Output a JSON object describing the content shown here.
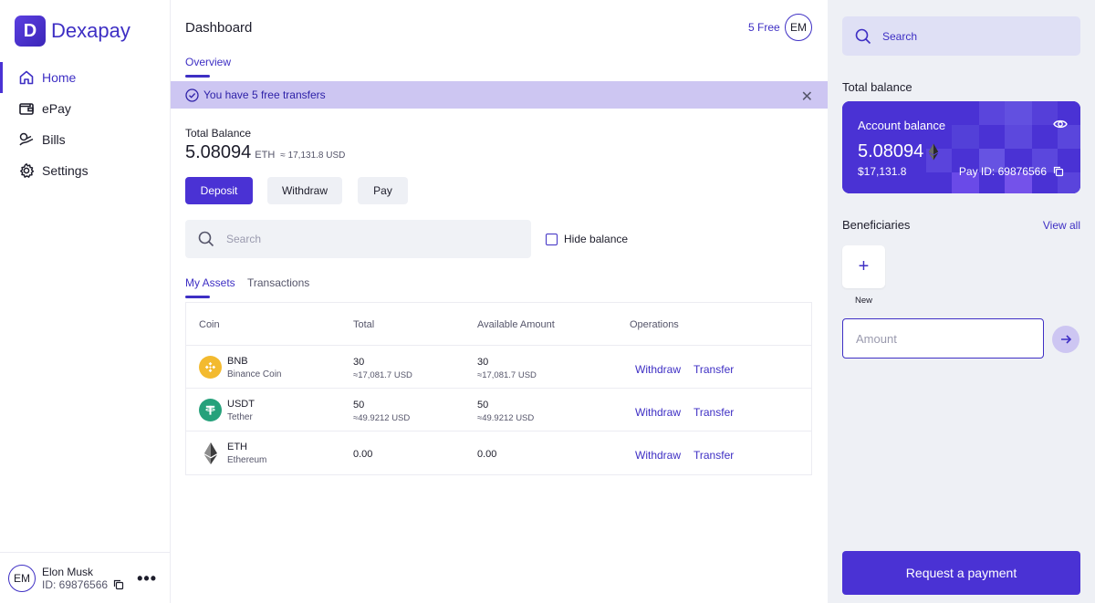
{
  "app": {
    "logo_letter": "D",
    "name": "Dexapay"
  },
  "sidebar": {
    "items": [
      {
        "label": "Home",
        "icon": "home-icon",
        "active": true
      },
      {
        "label": "ePay",
        "icon": "wallet-icon",
        "active": false
      },
      {
        "label": "Bills",
        "icon": "bills-icon",
        "active": false
      },
      {
        "label": "Settings",
        "icon": "gear-icon",
        "active": false
      }
    ],
    "user": {
      "initials": "EM",
      "name": "Elon Musk",
      "id": "ID: 69876566",
      "more": "•••"
    }
  },
  "header": {
    "title": "Dashboard",
    "free": "5 Free",
    "avatar_initials": "EM",
    "tab": "Overview"
  },
  "banner": {
    "text": "You have 5 free transfers",
    "close": "✕"
  },
  "balance": {
    "label": "Total Balance",
    "value": "5.08094",
    "unit": "ETH",
    "usd": "≈ 17,131.8 USD"
  },
  "actions": {
    "deposit": "Deposit",
    "withdraw": "Withdraw",
    "pay": "Pay"
  },
  "search": {
    "placeholder": "Search"
  },
  "hide_balance": "Hide balance",
  "subtabs": {
    "assets": "My Assets",
    "transactions": "Transactions"
  },
  "table": {
    "headers": {
      "coin": "Coin",
      "total": "Total",
      "available": "Available Amount",
      "operations": "Operations"
    },
    "rows": [
      {
        "symbol": "BNB",
        "name": "Binance Coin",
        "total": "30",
        "total_usd": "≈17,081.7 USD",
        "available": "30",
        "available_usd": "≈17,081.7 USD",
        "op1": "Withdraw",
        "op2": "Transfer",
        "icon": "bnb-icon",
        "color": "#f3ba2f"
      },
      {
        "symbol": "USDT",
        "name": "Tether",
        "total": "50",
        "total_usd": "≈49.9212 USD",
        "available": "50",
        "available_usd": "≈49.9212 USD",
        "op1": "Withdraw",
        "op2": "Transfer",
        "icon": "tether-icon",
        "color": "#26a17b"
      },
      {
        "symbol": "ETH",
        "name": "Ethereum",
        "total": "0.00",
        "total_usd": "",
        "available": "0.00",
        "available_usd": "",
        "op1": "Withdraw",
        "op2": "Transfer",
        "icon": "eth-icon",
        "color": "#3c3c3d"
      }
    ]
  },
  "right": {
    "search_placeholder": "Search",
    "total_balance_title": "Total balance",
    "card": {
      "label": "Account balance",
      "amount": "5.08094",
      "usd": "$17,131.8",
      "pay_id": "Pay ID: 69876566"
    },
    "beneficiaries": {
      "title": "Beneficiaries",
      "view_all": "View all",
      "new_label": "New",
      "plus": "+"
    },
    "amount_placeholder": "Amount",
    "request_button": "Request a payment"
  },
  "colors": {
    "accent": "#4a32d4",
    "banner_bg": "#cdc6f2",
    "panel_bg": "#eef0f5"
  }
}
